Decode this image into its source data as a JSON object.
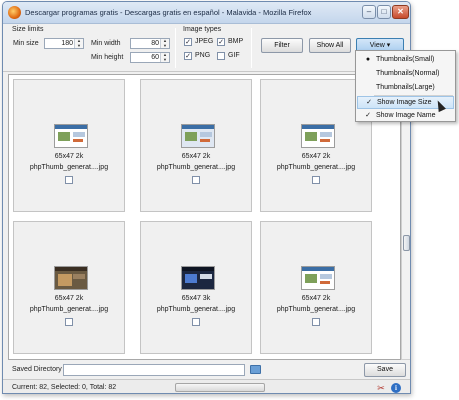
{
  "window": {
    "title": "Descargar programas gratis - Descargas gratis en español - Malavida - Mozilla Firefox",
    "minimize_label": "–",
    "maximize_label": "□",
    "close_label": "✕"
  },
  "toolbar": {
    "size_limits_title": "Size limits",
    "min_size_label": "Min size",
    "min_size_value": "180",
    "min_width_label": "Min width",
    "min_width_value": "80",
    "min_height_label": "Min height",
    "min_height_value": "60",
    "image_types_title": "Image types",
    "types": [
      {
        "label": "JPEG",
        "checked": true
      },
      {
        "label": "BMP",
        "checked": true
      },
      {
        "label": "PNG",
        "checked": true
      },
      {
        "label": "GIF",
        "checked": false
      }
    ],
    "filter_label": "Filter",
    "show_all_label": "Show All",
    "view_label": "View ▾"
  },
  "view_menu": {
    "items": [
      {
        "label": "Thumbnails(Small)",
        "mark": "●"
      },
      {
        "label": "Thumbnails(Normal)",
        "mark": ""
      },
      {
        "label": "Thumbnails(Large)",
        "mark": ""
      },
      {
        "label": "Show Image Size",
        "mark": "✓"
      },
      {
        "label": "Show Image Name",
        "mark": "✓"
      }
    ]
  },
  "images": [
    {
      "size": "65x47 2k",
      "name": "phpThumb_generat....jpg",
      "style": "style-a"
    },
    {
      "size": "65x47 2k",
      "name": "phpThumb_generat....jpg",
      "style": "style-b"
    },
    {
      "size": "65x47 2k",
      "name": "phpThumb_generat....jpg",
      "style": "style-a"
    },
    {
      "size": "65x47 2k",
      "name": "phpThumb_generat....jpg",
      "style": "style-c"
    },
    {
      "size": "65x47 3k",
      "name": "phpThumb_generat....jpg",
      "style": "style-d"
    },
    {
      "size": "65x47 2k",
      "name": "phpThumb_generat....jpg",
      "style": "style-a"
    }
  ],
  "bottom": {
    "saved_directory_label": "Saved Directory",
    "saved_directory_value": "",
    "save_label": "Save"
  },
  "status": {
    "text": "Current: 82, Selected: 0, Total: 82"
  },
  "icons": {
    "tool": "tools-icon",
    "info": "info-icon",
    "folder": "folder-icon"
  }
}
